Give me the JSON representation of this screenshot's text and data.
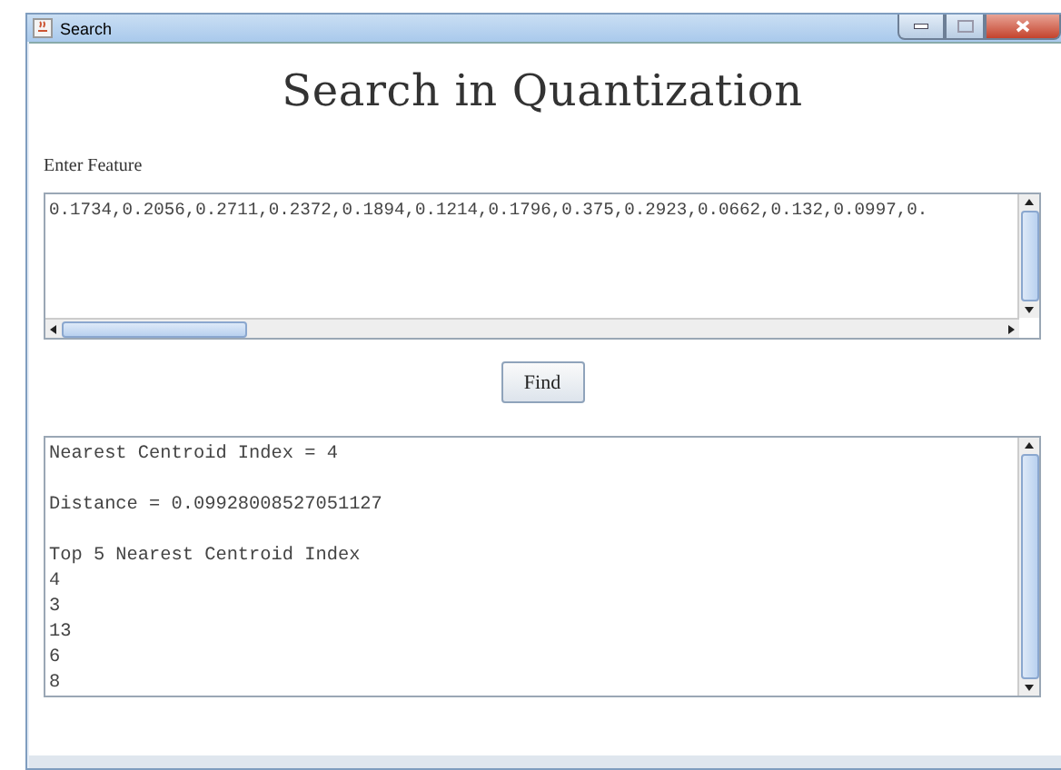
{
  "window": {
    "title": "Search"
  },
  "heading": "Search in Quantization",
  "feature_label": "Enter Feature",
  "feature_field": {
    "value": "0.1734,0.2056,0.2711,0.2372,0.1894,0.1214,0.1796,0.375,0.2923,0.0662,0.132,0.0997,0."
  },
  "find_button": "Find",
  "output": {
    "nearest_line": "Nearest Centroid Index = 4",
    "distance_line": "Distance = 0.09928008527051127",
    "top_heading": "Top 5 Nearest Centroid Index",
    "top_indices": [
      "4",
      "3",
      "13",
      "6",
      "8"
    ]
  }
}
